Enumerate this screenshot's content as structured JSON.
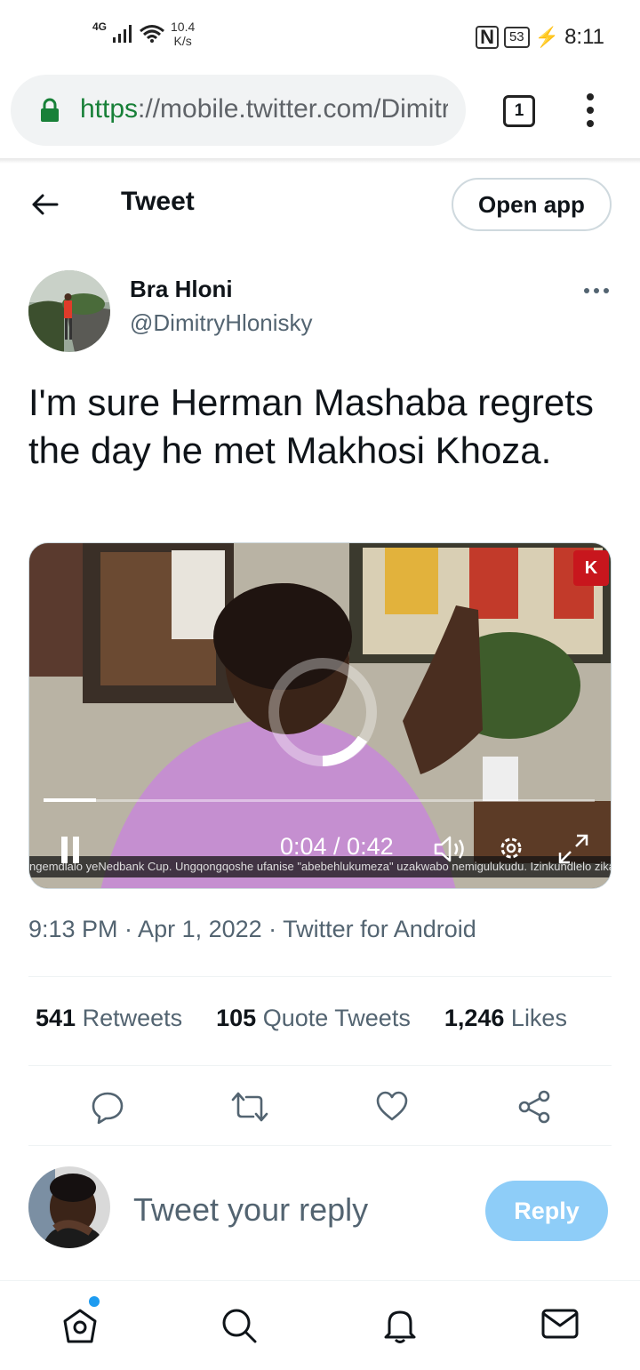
{
  "status_bar": {
    "network": "4G",
    "speed_value": "10.4",
    "speed_unit": "K/s",
    "nfc": "N",
    "battery": "53",
    "time": "8:11"
  },
  "browser": {
    "url_scheme": "https",
    "url_rest": "://mobile.twitter.com/DimitryHlonisky",
    "tab_count": "1"
  },
  "header": {
    "title": "Tweet",
    "open_app_label": "Open app"
  },
  "tweet": {
    "author_name": "Bra Hloni",
    "author_handle": "@DimitryHlonisky",
    "text": "I'm sure Herman Mashaba regrets the day he met Makhosi Khoza.",
    "video": {
      "current_time": "0:04",
      "duration": "0:42",
      "time_display": "0:04 / 0:42",
      "progress": 0.095,
      "ticker": "ngemdlalo yeNedbank Cup. Ungqongqoshe ufanise \"abebehlukumeza\" uzakwabo nemigulukudu. Izinkundlelo zika",
      "channel_logo": "K"
    },
    "meta": "9:13 PM · Apr 1, 2022 · Twitter for Android",
    "stats": [
      {
        "count": "541",
        "label": "Retweets"
      },
      {
        "count": "105",
        "label": "Quote Tweets"
      },
      {
        "count": "1,246",
        "label": "Likes"
      }
    ]
  },
  "reply": {
    "placeholder": "Tweet your reply",
    "button_label": "Reply"
  },
  "colors": {
    "accent": "#1d9bf0",
    "reply_button": "#8ecdf8",
    "secure": "#188038",
    "muted_text": "#536471"
  },
  "icons": {
    "actions": [
      "reply-icon",
      "retweet-icon",
      "like-icon",
      "share-icon"
    ],
    "nav": [
      "home-icon",
      "search-icon",
      "notifications-icon",
      "messages-icon"
    ]
  }
}
